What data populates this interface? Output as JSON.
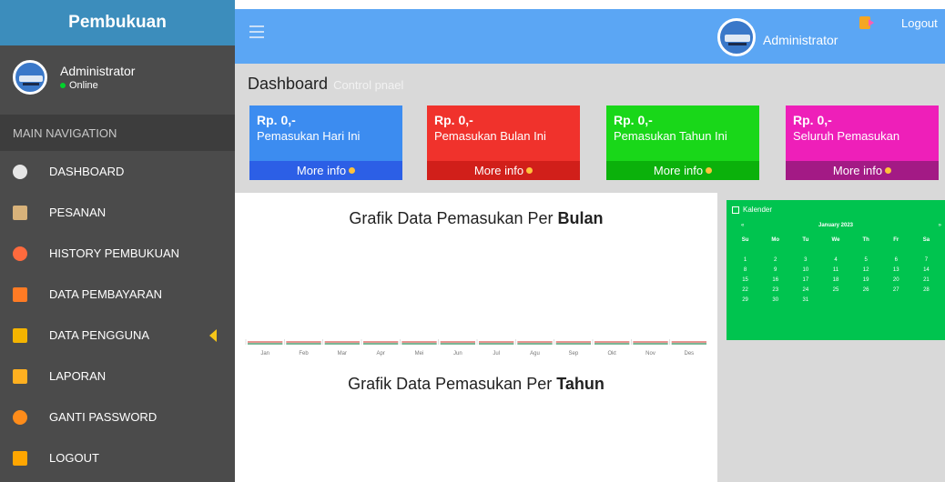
{
  "sidebar": {
    "brand": "Pembukuan",
    "user": {
      "name": "Administrator",
      "status": "Online"
    },
    "nav_header": "MAIN NAVIGATION",
    "items": [
      {
        "label": "DASHBOARD",
        "icon": "dashboard-icon",
        "color": "#e6e6e6"
      },
      {
        "label": "PESANAN",
        "icon": "clipboard-icon",
        "color": "#d8b27a"
      },
      {
        "label": "HISTORY PEMBUKUAN",
        "icon": "history-icon",
        "color": "#ff6a3d"
      },
      {
        "label": "DATA PEMBAYARAN",
        "icon": "folder-icon",
        "color": "#ff7b24"
      },
      {
        "label": "DATA PENGGUNA",
        "icon": "user-doc-icon",
        "color": "#f4b400"
      },
      {
        "label": "LAPORAN",
        "icon": "report-icon",
        "color": "#ffb020"
      },
      {
        "label": "GANTI PASSWORD",
        "icon": "lock-icon",
        "color": "#ff8c1a"
      },
      {
        "label": "LOGOUT",
        "icon": "logout-icon",
        "color": "#ffa600"
      }
    ]
  },
  "topbar": {
    "admin": "Administrator",
    "logout": "Logout"
  },
  "content": {
    "title": "Dashboard",
    "subtitle": "Control pnael",
    "boxes": [
      {
        "amount": "Rp. 0,-",
        "label": "Pemasukan Hari Ini",
        "more": "More info",
        "color": "#3c8cf0",
        "foot": "#2c5fe6"
      },
      {
        "amount": "Rp. 0,-",
        "label": "Pemasukan Bulan Ini",
        "more": "More info",
        "color": "#f0322c",
        "foot": "#d11f1a"
      },
      {
        "amount": "Rp. 0,-",
        "label": "Pemasukan Tahun Ini",
        "more": "More info",
        "color": "#19d719",
        "foot": "#0bb10b"
      },
      {
        "amount": "Rp. 0,-",
        "label": "Seluruh Pemasukan",
        "more": "More info",
        "color": "#ee1fb9",
        "foot": "#a31a85"
      }
    ],
    "chart_month_title_prefix": "Grafik Data Pemasukan Per",
    "chart_month_title_bold": "Bulan",
    "chart_year_title_prefix": "Grafik Data Pemasukan Per",
    "chart_year_title_bold": "Tahun"
  },
  "chart_data": {
    "type": "line",
    "categories": [
      "Jan",
      "Feb",
      "Mar",
      "Apr",
      "Mei",
      "Jun",
      "Jul",
      "Agu",
      "Sep",
      "Okt",
      "Nov",
      "Des"
    ],
    "series": [
      {
        "values": [
          0,
          0,
          0,
          0,
          0,
          0,
          0,
          0,
          0,
          0,
          0,
          0
        ],
        "color": "#d9534f"
      },
      {
        "values": [
          0,
          0,
          0,
          0,
          0,
          0,
          0,
          0,
          0,
          0,
          0,
          0
        ],
        "color": "#2e8b57"
      }
    ]
  },
  "calendar": {
    "title": "Kalender",
    "month": "January 2023",
    "prev": "«",
    "next": "»",
    "dow": [
      "Su",
      "Mo",
      "Tu",
      "We",
      "Th",
      "Fr",
      "Sa"
    ],
    "days": [
      "1",
      "2",
      "3",
      "4",
      "5",
      "6",
      "7",
      "8",
      "9",
      "10",
      "11",
      "12",
      "13",
      "14",
      "15",
      "16",
      "17",
      "18",
      "19",
      "20",
      "21",
      "22",
      "23",
      "24",
      "25",
      "26",
      "27",
      "28",
      "29",
      "30",
      "31"
    ]
  }
}
